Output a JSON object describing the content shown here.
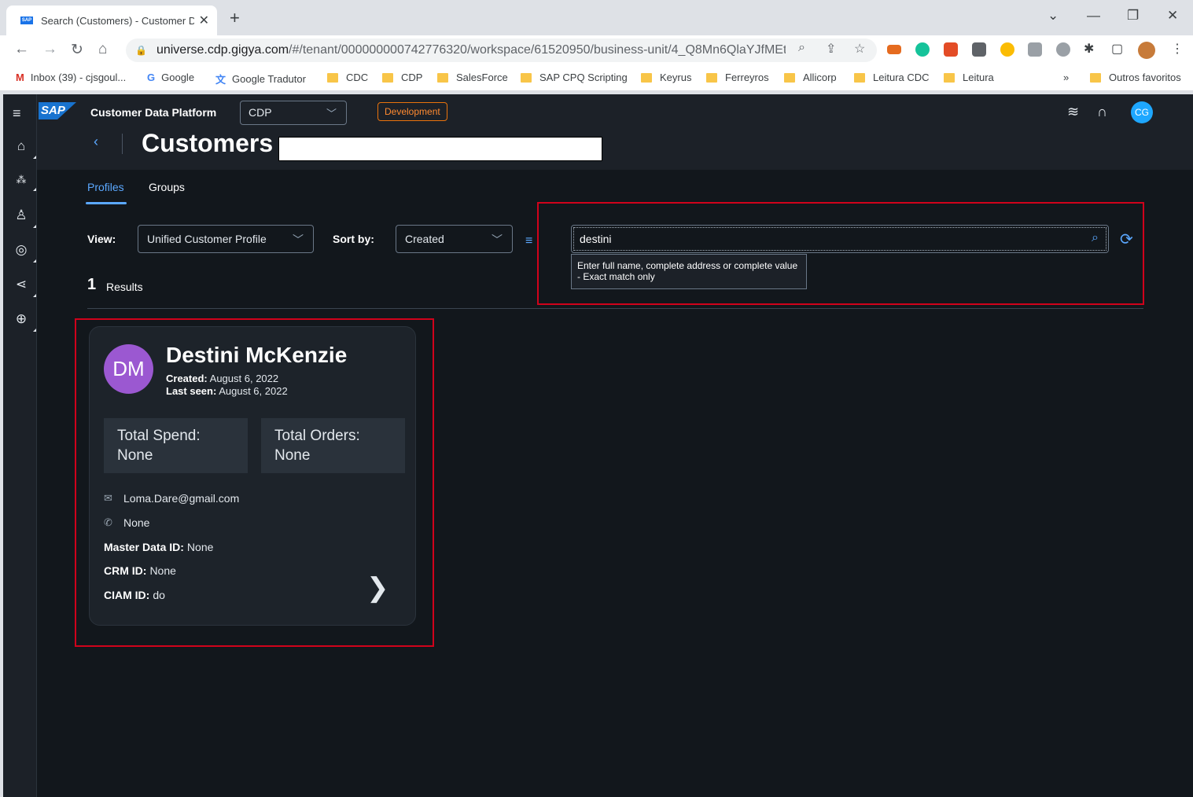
{
  "browser": {
    "tab_title": "Search (Customers) - Customer D",
    "url_host": "universe.cdp.gigya.com",
    "url_path": "/#/tenant/000000000742776320/workspace/61520950/business-unit/4_Q8Mn6QlaYJfMEtWl...",
    "bookmarks": [
      "Inbox (39) - cjsgoul...",
      "Google",
      "Google Tradutor",
      "CDC",
      "CDP",
      "SalesForce",
      "SAP CPQ Scripting",
      "Keyrus",
      "Ferreyros",
      "Allicorp",
      "Leitura CDC",
      "Leitura"
    ],
    "bookmarks_more": "»",
    "other_bookmarks": "Outros favoritos"
  },
  "shell": {
    "logo": "SAP",
    "product": "Customer Data Platform",
    "workspace": "CDP",
    "env_badge": "Development",
    "user_initials": "CG"
  },
  "page": {
    "title": "Customers",
    "tabs": [
      "Profiles",
      "Groups"
    ],
    "active_tab": "Profiles"
  },
  "filters": {
    "view_label": "View:",
    "view_value": "Unified Customer Profile",
    "sort_label": "Sort by:",
    "sort_value": "Created",
    "search_value": "destini",
    "search_tooltip_line1": "Enter full name, complete address or complete value",
    "search_tooltip_line2": "- Exact match only"
  },
  "results": {
    "count": "1",
    "label": "Results"
  },
  "card": {
    "initials": "DM",
    "name": "Destini McKenzie",
    "created_label": "Created:",
    "created_value": "August 6, 2022",
    "last_seen_label": "Last seen:",
    "last_seen_value": "August 6, 2022",
    "total_spend_label": "Total Spend:",
    "total_spend_value": "None",
    "total_orders_label": "Total Orders:",
    "total_orders_value": "None",
    "email": "Loma.Dare@gmail.com",
    "phone": "None",
    "master_id_label": "Master Data ID:",
    "master_id_value": "None",
    "crm_id_label": "CRM ID:",
    "crm_id_value": "None",
    "ciam_id_label": "CIAM ID:",
    "ciam_id_value": "do"
  },
  "colors": {
    "accent": "#5ba8ff",
    "avatar": "#9b58d1",
    "highlight": "#d0021b",
    "badge": "#e9730c"
  }
}
